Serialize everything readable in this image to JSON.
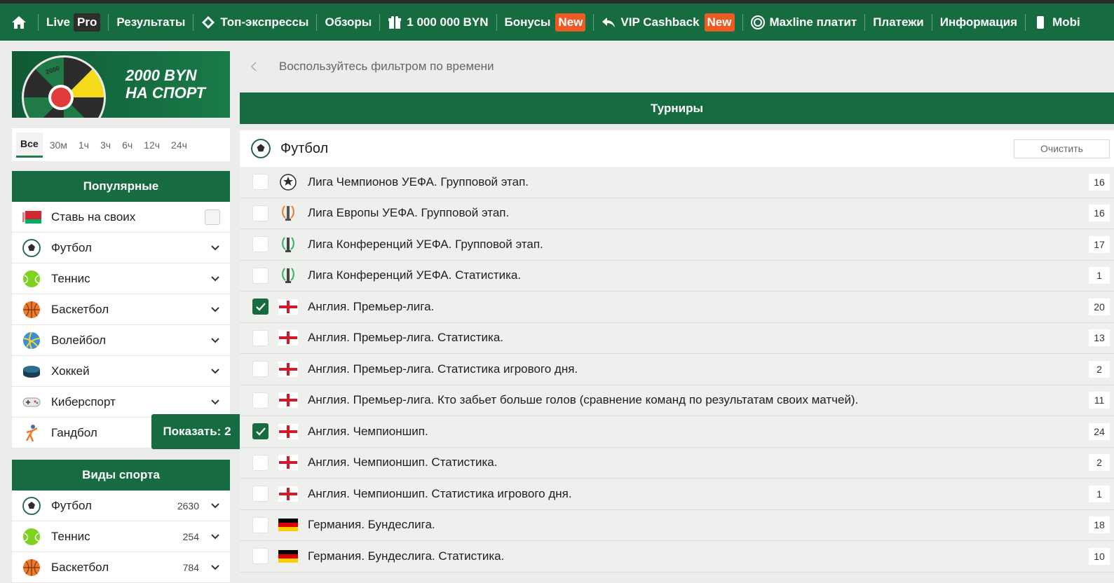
{
  "nav": {
    "items": [
      {
        "label": "Live",
        "badge": "Pro"
      },
      {
        "label": "Результаты"
      },
      {
        "label": "Топ-экспрессы"
      },
      {
        "label": "Обзоры"
      },
      {
        "label": "1 000 000 BYN"
      },
      {
        "label": "Бонусы",
        "badge": "New"
      },
      {
        "label": "VIP Cashback",
        "badge": "New"
      },
      {
        "label": "Maxline платит"
      },
      {
        "label": "Платежи"
      },
      {
        "label": "Информация"
      },
      {
        "label": "Mobi"
      }
    ]
  },
  "promo": {
    "title_line1": "2000 BYN",
    "title_line2": "НА СПОРТ",
    "wheel_label": "2000"
  },
  "time_filter": [
    "Все",
    "30м",
    "1ч",
    "3ч",
    "6ч",
    "12ч",
    "24ч"
  ],
  "popular": {
    "title": "Популярные",
    "items": [
      {
        "label": "Ставь на своих",
        "icon": "belarus-flag-icon"
      },
      {
        "label": "Футбол",
        "icon": "football-icon"
      },
      {
        "label": "Теннис",
        "icon": "tennis-ball-icon"
      },
      {
        "label": "Баскетбол",
        "icon": "basketball-icon"
      },
      {
        "label": "Волейбол",
        "icon": "volleyball-icon"
      },
      {
        "label": "Хоккей",
        "icon": "hockey-puck-icon"
      },
      {
        "label": "Киберспорт",
        "icon": "gamepad-icon"
      },
      {
        "label": "Гандбол",
        "icon": "handball-player-icon"
      }
    ]
  },
  "tooltip": "Показать: 2",
  "sports": {
    "title": "Виды спорта",
    "items": [
      {
        "label": "Футбол",
        "count": "2630"
      },
      {
        "label": "Теннис",
        "count": "254"
      },
      {
        "label": "Баскетбол",
        "count": "784"
      }
    ]
  },
  "main": {
    "hint": "Воспользуйтесь фильтром по времени",
    "tournaments_title": "Турниры",
    "sport_title": "Футбол",
    "clear_label": "Очистить",
    "rows": [
      {
        "name": "Лига Чемпионов УЕФА. Групповой этап.",
        "count": "16",
        "checked": false,
        "flag": "champions-league"
      },
      {
        "name": "Лига Европы УЕФА. Групповой этап.",
        "count": "16",
        "checked": false,
        "flag": "europa-league"
      },
      {
        "name": "Лига Конференций УЕФА. Групповой этап.",
        "count": "17",
        "checked": false,
        "flag": "conference-league"
      },
      {
        "name": "Лига Конференций УЕФА. Статистика.",
        "count": "1",
        "checked": false,
        "flag": "conference-league"
      },
      {
        "name": "Англия. Премьер-лига.",
        "count": "20",
        "checked": true,
        "flag": "england"
      },
      {
        "name": "Англия. Премьер-лига. Статистика.",
        "count": "13",
        "checked": false,
        "flag": "england"
      },
      {
        "name": "Англия. Премьер-лига. Статистика игрового дня.",
        "count": "2",
        "checked": false,
        "flag": "england"
      },
      {
        "name": "Англия. Премьер-лига. Кто забьет больше голов (сравнение команд по результатам своих матчей).",
        "count": "11",
        "checked": false,
        "flag": "england"
      },
      {
        "name": "Англия. Чемпионшип.",
        "count": "24",
        "checked": true,
        "flag": "england"
      },
      {
        "name": "Англия. Чемпионшип. Статистика.",
        "count": "2",
        "checked": false,
        "flag": "england"
      },
      {
        "name": "Англия. Чемпионшип. Статистика игрового дня.",
        "count": "1",
        "checked": false,
        "flag": "england"
      },
      {
        "name": "Германия. Бундеслига.",
        "count": "18",
        "checked": false,
        "flag": "germany"
      },
      {
        "name": "Германия. Бундеслига. Статистика.",
        "count": "10",
        "checked": false,
        "flag": "germany"
      }
    ]
  },
  "colors": {
    "brand_green": "#166b41",
    "badge_orange": "#ee5a24",
    "badge_dark": "#2d2d2d"
  }
}
